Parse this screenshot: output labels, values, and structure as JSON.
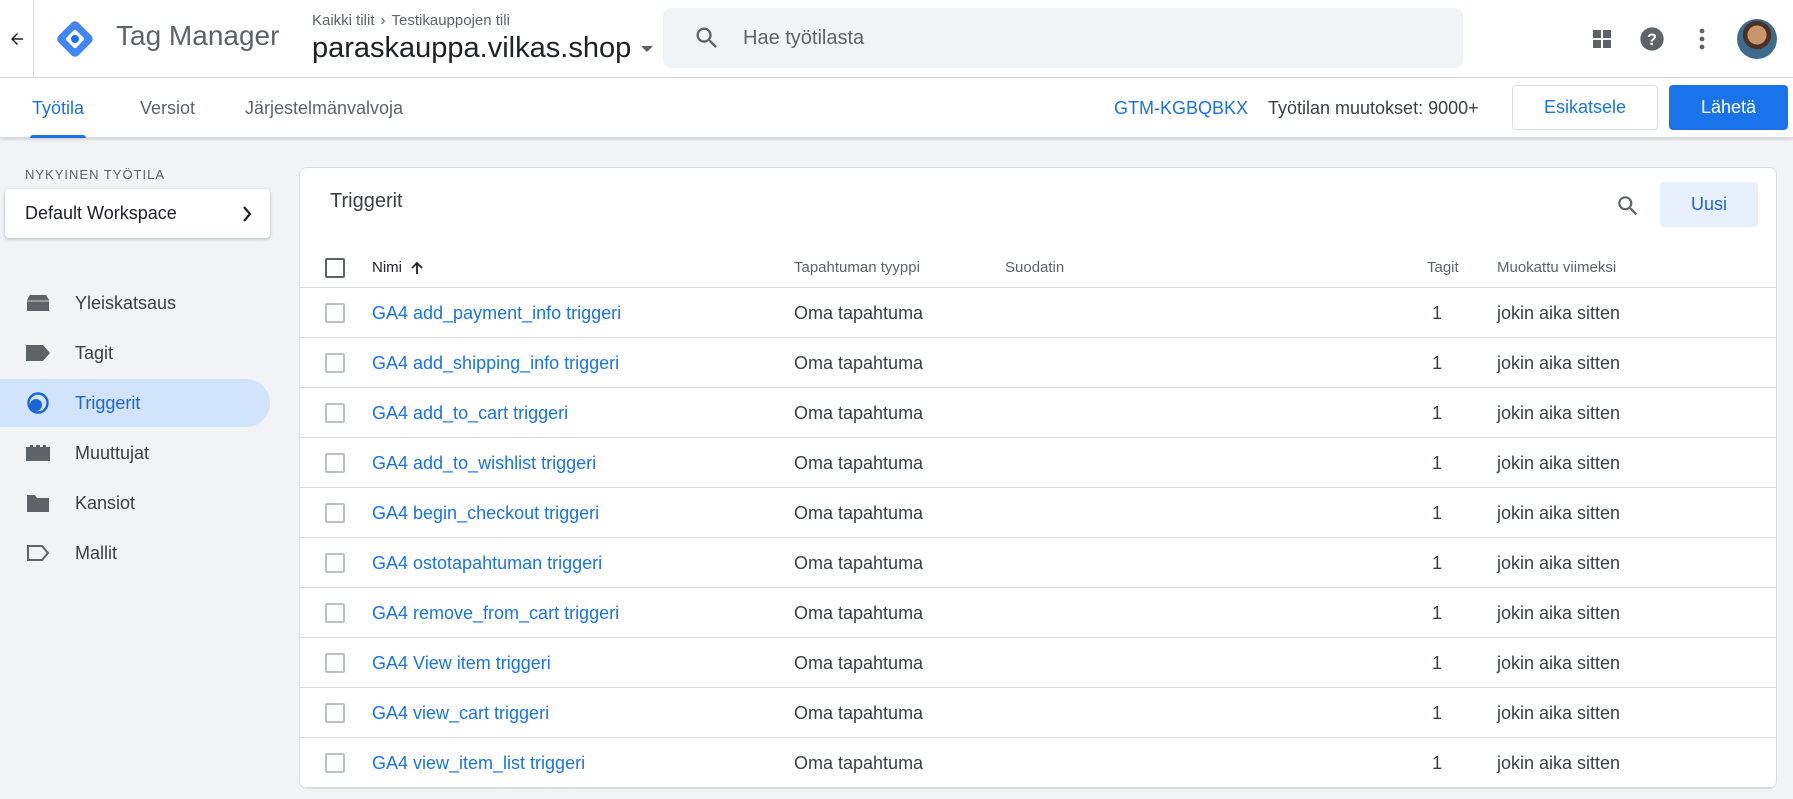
{
  "app": {
    "name": "Tag Manager",
    "breadcrumb": [
      "Kaikki tilit",
      "Testikauppojen tili"
    ],
    "container": "paraskauppa.vilkas.shop",
    "search_placeholder": "Hae työtilasta"
  },
  "tabs": [
    {
      "label": "Työtila",
      "active": true
    },
    {
      "label": "Versiot",
      "active": false
    },
    {
      "label": "Järjestelmänvalvoja",
      "active": false
    }
  ],
  "subbar": {
    "container_id": "GTM-KGBQBKX",
    "changes": "Työtilan muutokset: 9000+",
    "preview_label": "Esikatsele",
    "submit_label": "Lähetä"
  },
  "sidebar": {
    "workspace_label": "NYKYINEN TYÖTILA",
    "workspace_name": "Default Workspace",
    "items": [
      {
        "label": "Yleiskatsaus",
        "icon": "overview-icon",
        "active": false
      },
      {
        "label": "Tagit",
        "icon": "tag-icon",
        "active": false
      },
      {
        "label": "Triggerit",
        "icon": "trigger-icon",
        "active": true
      },
      {
        "label": "Muuttujat",
        "icon": "variables-icon",
        "active": false
      },
      {
        "label": "Kansiot",
        "icon": "folder-icon",
        "active": false
      },
      {
        "label": "Mallit",
        "icon": "template-icon",
        "active": false
      }
    ]
  },
  "table": {
    "title": "Triggerit",
    "new_label": "Uusi",
    "columns": [
      "Nimi",
      "Tapahtuman tyyppi",
      "Suodatin",
      "Tagit",
      "Muokattu viimeksi"
    ],
    "rows": [
      {
        "name": "GA4 add_payment_info triggeri",
        "type": "Oma tapahtuma",
        "filter": "",
        "tags": "1",
        "modified": "jokin aika sitten"
      },
      {
        "name": "GA4 add_shipping_info triggeri",
        "type": "Oma tapahtuma",
        "filter": "",
        "tags": "1",
        "modified": "jokin aika sitten"
      },
      {
        "name": "GA4 add_to_cart triggeri",
        "type": "Oma tapahtuma",
        "filter": "",
        "tags": "1",
        "modified": "jokin aika sitten"
      },
      {
        "name": "GA4 add_to_wishlist triggeri",
        "type": "Oma tapahtuma",
        "filter": "",
        "tags": "1",
        "modified": "jokin aika sitten"
      },
      {
        "name": "GA4 begin_checkout triggeri",
        "type": "Oma tapahtuma",
        "filter": "",
        "tags": "1",
        "modified": "jokin aika sitten"
      },
      {
        "name": "GA4 ostotapahtuman triggeri",
        "type": "Oma tapahtuma",
        "filter": "",
        "tags": "1",
        "modified": "jokin aika sitten"
      },
      {
        "name": "GA4 remove_from_cart triggeri",
        "type": "Oma tapahtuma",
        "filter": "",
        "tags": "1",
        "modified": "jokin aika sitten"
      },
      {
        "name": "GA4 View item triggeri",
        "type": "Oma tapahtuma",
        "filter": "",
        "tags": "1",
        "modified": "jokin aika sitten"
      },
      {
        "name": "GA4 view_cart triggeri",
        "type": "Oma tapahtuma",
        "filter": "",
        "tags": "1",
        "modified": "jokin aika sitten"
      },
      {
        "name": "GA4 view_item_list triggeri",
        "type": "Oma tapahtuma",
        "filter": "",
        "tags": "1",
        "modified": "jokin aika sitten"
      }
    ]
  },
  "colors": {
    "accent": "#1a73e8",
    "active_nav_bg": "#d2e3fc",
    "logo_blue": "#4285f4",
    "logo_dark": "#1a73e8"
  }
}
